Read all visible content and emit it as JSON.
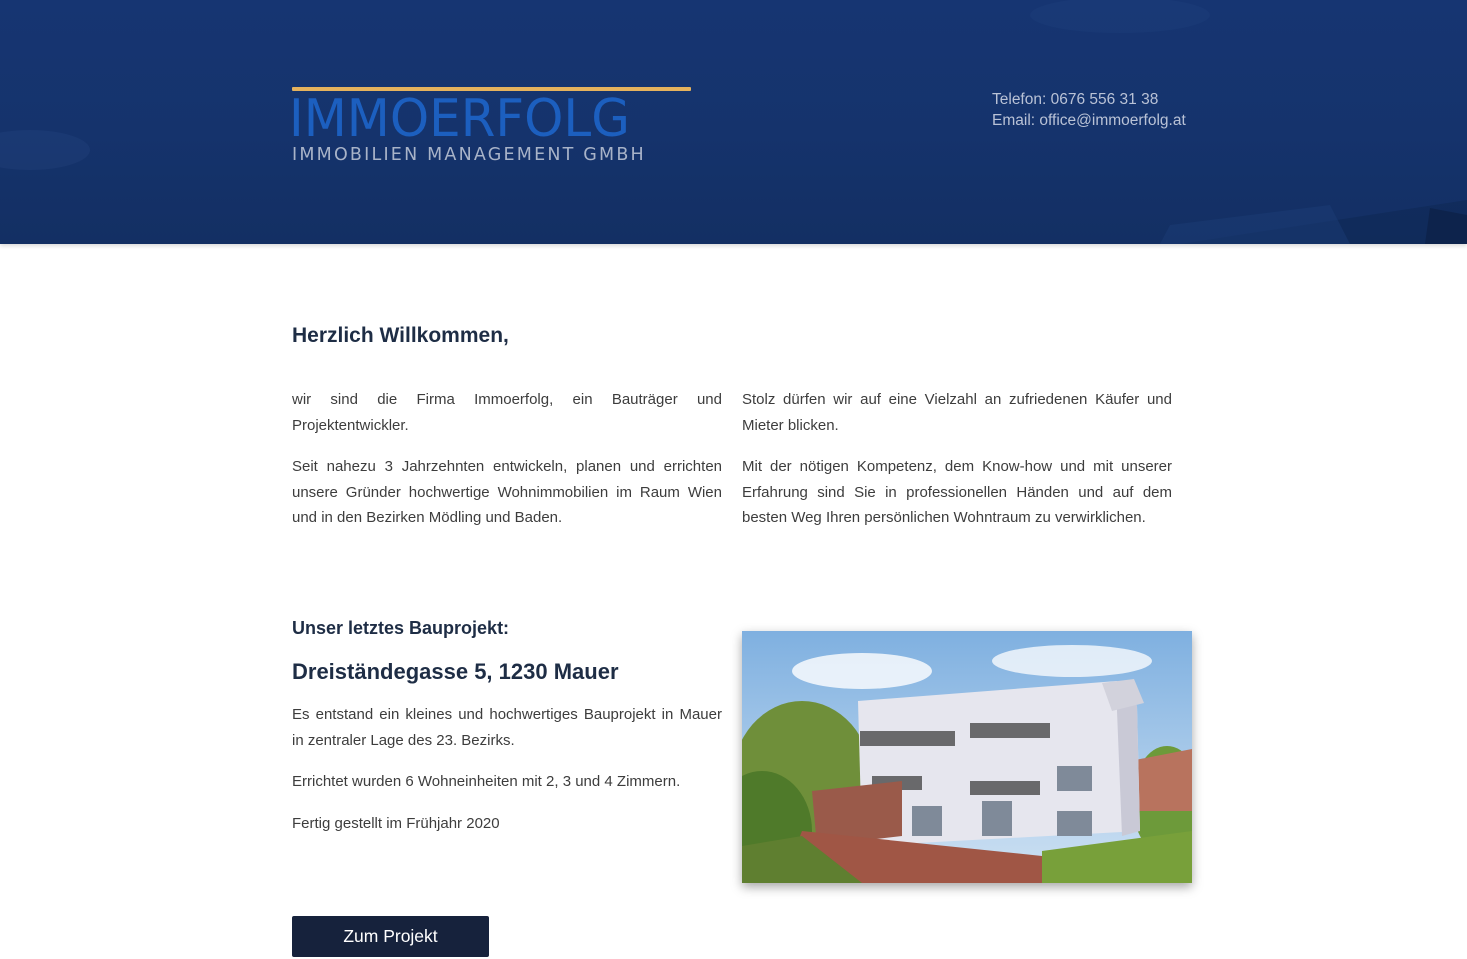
{
  "header": {
    "logo_name": "IMMOERFOLG",
    "logo_sub": "IMMOBILIEN MANAGEMENT GMBH",
    "phone_text": "Telefon: 0676 556 31 38",
    "email_text": "Email: office@immoerfolg.at",
    "accent_color": "#e5b25d",
    "brand_color": "#1c5fbf",
    "header_bg": "#15336c"
  },
  "welcome": {
    "title": "Herzlich Willkommen,",
    "left_paragraphs": [
      "wir sind die Firma Immoerfolg, ein Bauträger und Projektentwickler.",
      "Seit nahezu 3 Jahrzehnten entwickeln, planen und errichten unsere Gründer hochwertige Wohnimmobilien im Raum Wien und in den Bezirken Mödling und Baden."
    ],
    "right_paragraphs": [
      "Stolz dürfen wir auf eine Vielzahl an zufriedenen Käufer und Mieter blicken.",
      "Mit der nötigen Kompetenz, dem Know-how und mit unserer Erfahrung sind Sie in professionellen Händen und auf dem besten Weg Ihren persönlichen Wohntraum zu verwirklichen."
    ]
  },
  "project": {
    "label": "Unser letztes Bauprojekt:",
    "title": "Dreiständegasse 5, 1230 Mauer",
    "paragraphs": [
      "Es entstand ein kleines und hochwertiges Bauprojekt in Mauer in zentraler Lage des 23. Bezirks.",
      "Errichtet wurden 6 Wohneinheiten mit 2, 3 und 4 Zimmern.",
      "Fertig gestellt im Frühjahr 2020"
    ],
    "button_label": "Zum Projekt",
    "button_color": "#16223c"
  }
}
